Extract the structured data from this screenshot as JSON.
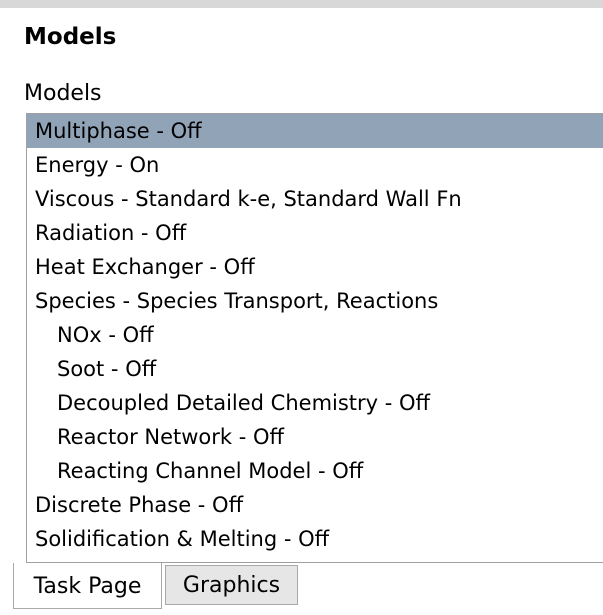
{
  "panel": {
    "title": "Models"
  },
  "models_group": {
    "label": "Models",
    "items": [
      {
        "label": "Multiphase - Off",
        "selected": true,
        "child": false
      },
      {
        "label": "Energy - On",
        "selected": false,
        "child": false
      },
      {
        "label": "Viscous - Standard k-e, Standard Wall Fn",
        "selected": false,
        "child": false
      },
      {
        "label": "Radiation - Off",
        "selected": false,
        "child": false
      },
      {
        "label": "Heat Exchanger - Off",
        "selected": false,
        "child": false
      },
      {
        "label": "Species - Species Transport, Reactions",
        "selected": false,
        "child": false
      },
      {
        "label": "NOx - Off",
        "selected": false,
        "child": true
      },
      {
        "label": "Soot - Off",
        "selected": false,
        "child": true
      },
      {
        "label": "Decoupled Detailed Chemistry - Off",
        "selected": false,
        "child": true
      },
      {
        "label": "Reactor Network - Off",
        "selected": false,
        "child": true
      },
      {
        "label": "Reacting Channel Model - Off",
        "selected": false,
        "child": true
      },
      {
        "label": "Discrete Phase - Off",
        "selected": false,
        "child": false
      },
      {
        "label": "Solidification & Melting - Off",
        "selected": false,
        "child": false
      }
    ]
  },
  "tabs": [
    {
      "label": "Task Page",
      "active": true
    },
    {
      "label": "Graphics",
      "active": false
    }
  ],
  "colors": {
    "selection": "#91a3b7",
    "inactive_tab": "#e6e6e6"
  }
}
